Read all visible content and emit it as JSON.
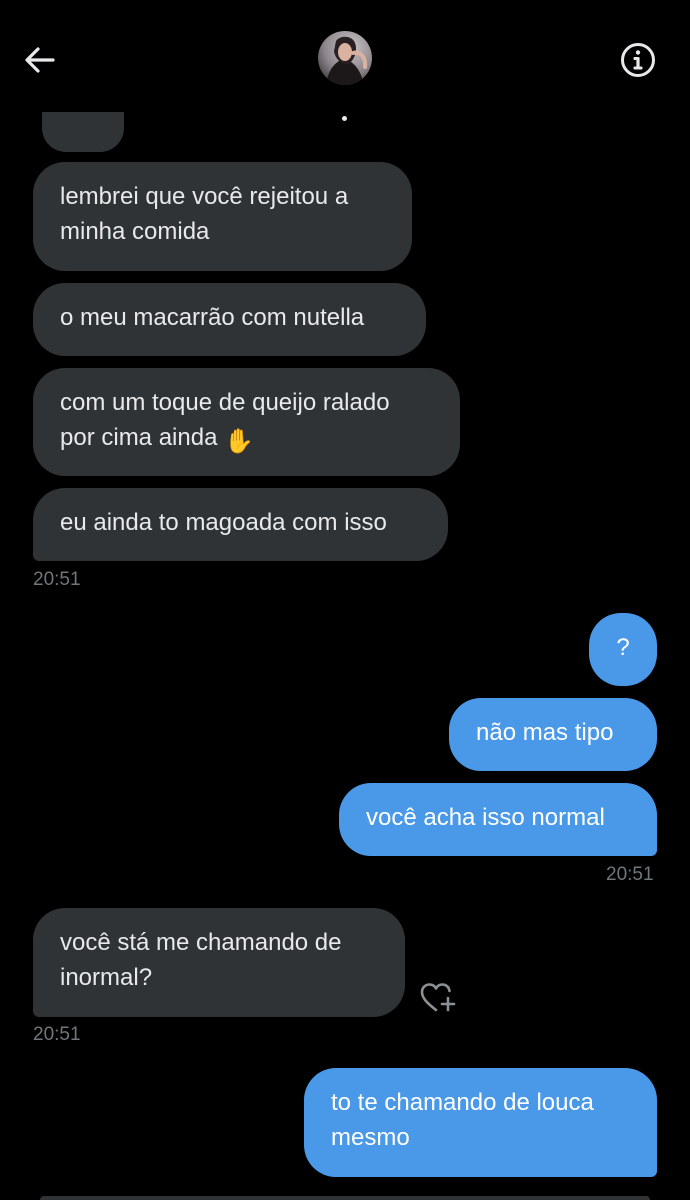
{
  "header": {
    "back_icon": "arrow-left-icon",
    "info_icon": "info-circle-icon",
    "avatar": "profile-photo"
  },
  "messages": [
    {
      "side": "in",
      "text": "lembrei que você rejeitou a\nminha comida"
    },
    {
      "side": "in",
      "text": "o meu macarrão com nutella"
    },
    {
      "side": "in",
      "text": "com um toque de queijo ralado\npor cima ainda",
      "emoji": "✋"
    },
    {
      "side": "in",
      "text": "eu ainda to magoada com isso"
    },
    {
      "side": "out",
      "text": "?"
    },
    {
      "side": "out",
      "text": "não mas tipo"
    },
    {
      "side": "out",
      "text": "você acha isso normal"
    },
    {
      "side": "in",
      "text": "você stá me chamando de\ninormal?"
    },
    {
      "side": "out",
      "text": "to te chamando de louca\nmesmo"
    }
  ],
  "timestamps": {
    "group1": "20:51",
    "group2": "20:51",
    "group3": "20:51"
  },
  "colors": {
    "background": "#000000",
    "incoming_bubble": "#2f3336",
    "outgoing_bubble": "#4a99e9",
    "timestamp": "#71767b"
  }
}
